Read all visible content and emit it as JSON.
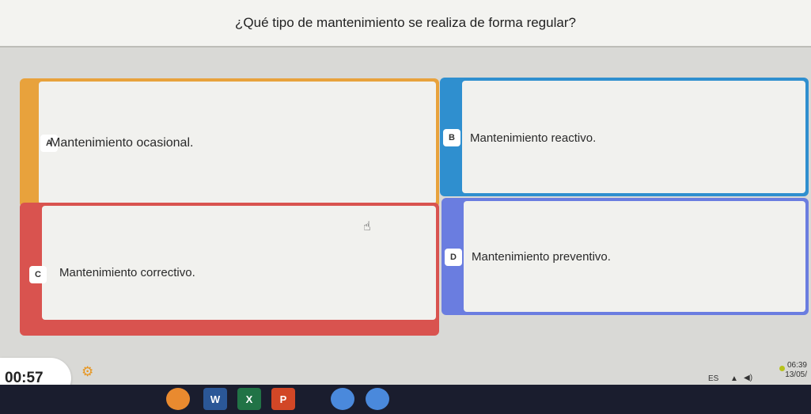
{
  "question": "¿Qué tipo de mantenimiento se realiza de forma regular?",
  "options": [
    {
      "letter": "A",
      "text": "Mantenimiento ocasional.",
      "color": "#e8a23c"
    },
    {
      "letter": "B",
      "text": "Mantenimiento reactivo.",
      "color": "#2f8fcf"
    },
    {
      "letter": "C",
      "text": "Mantenimiento correctivo.",
      "color": "#d9534f"
    },
    {
      "letter": "D",
      "text": "Mantenimiento preventivo.",
      "color": "#6a7de0"
    }
  ],
  "timer": "00:57",
  "tray": {
    "language": "ES",
    "time": "06:39",
    "date": "13/05/"
  },
  "taskbar_icons": [
    "app-icon",
    "word-icon",
    "excel-icon",
    "powerpoint-icon",
    "chrome-icon",
    "chrome-icon"
  ],
  "taskbar_labels": {
    "word": "W",
    "excel": "X",
    "ppt": "P"
  }
}
